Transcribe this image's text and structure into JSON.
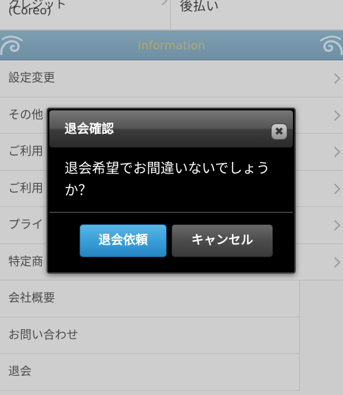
{
  "top_row": {
    "left_line1": "クレジット",
    "left_line2": "(Coreo)",
    "right_label": "後払い"
  },
  "info_bar": {
    "title": "Information"
  },
  "menu": {
    "items": [
      {
        "label": "設定変更"
      },
      {
        "label": "その他"
      },
      {
        "label": "ご利用"
      },
      {
        "label": "ご利用"
      },
      {
        "label": "プライ"
      },
      {
        "label": "特定商"
      },
      {
        "label": "会社概要"
      },
      {
        "label": "お問い合わせ"
      },
      {
        "label": "退会"
      }
    ]
  },
  "dialog": {
    "title": "退会確認",
    "close_glyph": "✖",
    "message": "退会希望でお間違いないでしょうか？",
    "confirm_label": "退会依頼",
    "cancel_label": "キャンセル"
  },
  "colors": {
    "accent_blue": "#3a9fd8",
    "info_bar": "#8fb3c9",
    "info_text": "#c8c27a"
  }
}
